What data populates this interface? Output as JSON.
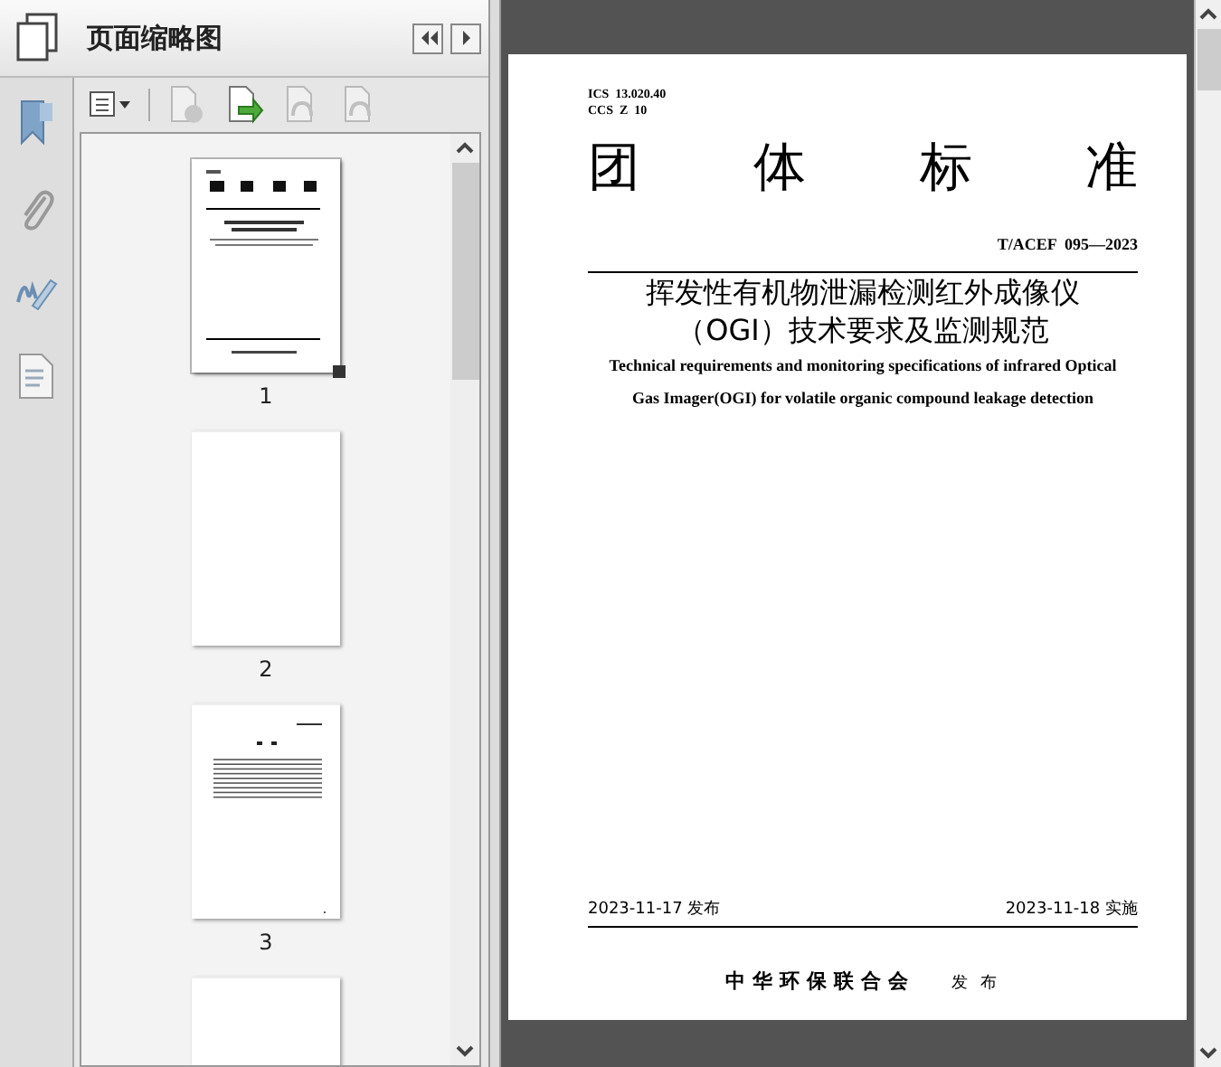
{
  "panel": {
    "title": "页面缩略图"
  },
  "toolbar": [
    {
      "kind": "options",
      "disabled": false
    },
    {
      "kind": "delete",
      "disabled": true
    },
    {
      "kind": "insert",
      "disabled": false
    },
    {
      "kind": "undo",
      "disabled": true
    },
    {
      "kind": "redo",
      "disabled": true
    }
  ],
  "rail": [
    {
      "kind": "bookmark",
      "selected": false
    },
    {
      "kind": "attachment",
      "selected": false
    },
    {
      "kind": "signature",
      "selected": false
    },
    {
      "kind": "pages",
      "selected": false
    }
  ],
  "thumbnails": [
    {
      "kind": "cover",
      "label": "1",
      "selected": true
    },
    {
      "kind": "blank",
      "label": "2",
      "selected": false
    },
    {
      "kind": "contents",
      "label": "3",
      "selected": false
    },
    {
      "kind": "blank",
      "selected": false
    }
  ],
  "page": {
    "codes": [
      "ICS  13.020.40",
      "CCS  Z  10"
    ],
    "heading": [
      "团",
      "体",
      "标",
      "准"
    ],
    "number": "T/ACEF  095—2023",
    "title_zh": [
      "挥发性有机物泄漏检测红外成像仪",
      "（OGI）技术要求及监测规范"
    ],
    "title_en": [
      "Technical requirements and monitoring specifications of infrared Optical",
      "Gas Imager(OGI) for volatile organic compound leakage detection"
    ],
    "issued": "2023-11-17 发布",
    "effective": "2023-11-18 实施",
    "publisher": "中华环保联合会",
    "publish_word": "发 布"
  }
}
